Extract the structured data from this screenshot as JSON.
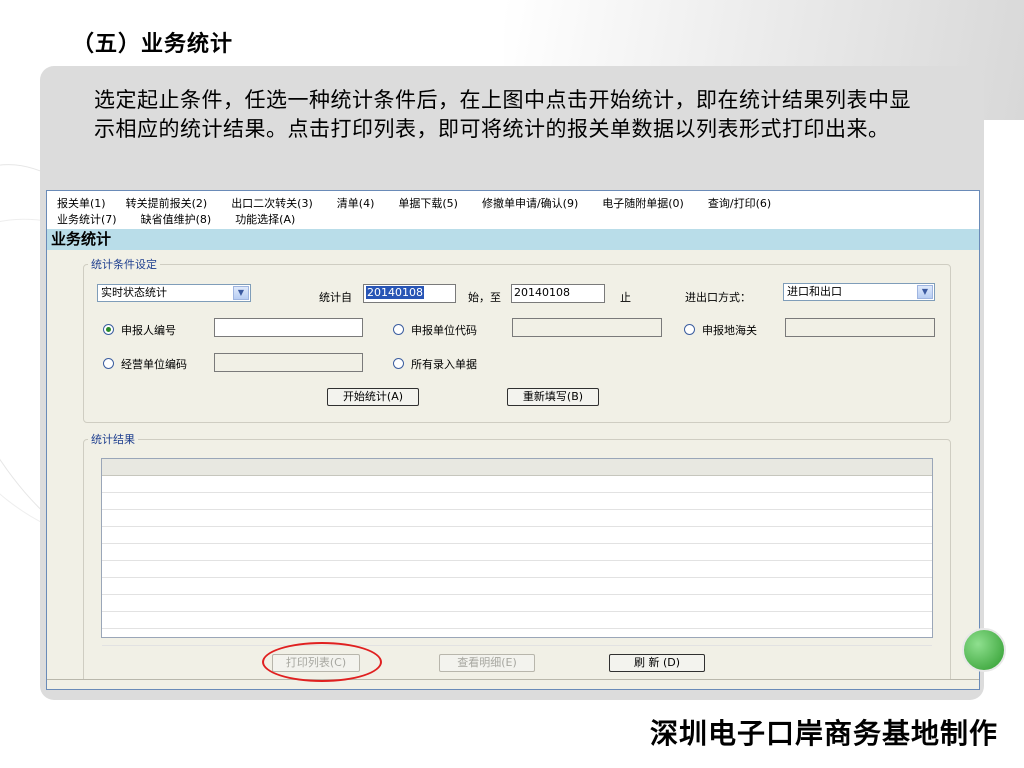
{
  "slide": {
    "title": "（五）业务统计",
    "description": "选定起止条件，任选一种统计条件后，在上图中点击开始统计，即在统计结果列表中显示相应的统计结果。点击打印列表，即可将统计的报关单数据以列表形式打印出来。",
    "footer": "深圳电子口岸商务基地制作"
  },
  "menu": {
    "row1": [
      "报关单(1)",
      "转关提前报关(2)",
      "出口二次转关(3)",
      "清单(4)",
      "单据下载(5)",
      "修撤单申请/确认(9)",
      "电子随附单据(0)",
      "查询/打印(6)"
    ],
    "row2": [
      "业务统计(7)",
      "缺省值维护(8)",
      "功能选择(A)"
    ]
  },
  "window": {
    "title": "业务统计"
  },
  "conditions": {
    "legend": "统计条件设定",
    "stat_type": "实时状态统计",
    "date_from_label": "统计自",
    "date_from": "20140108",
    "date_to_label": "始，至",
    "date_to": "20140108",
    "date_end_label": "止",
    "io_label": "进出口方式：",
    "io_value": "进口和出口",
    "radio_declarer_no": "申报人编号",
    "radio_declare_unit": "申报单位代码",
    "radio_declare_customs": "申报地海关",
    "radio_operating_unit": "经营单位编码",
    "radio_all_entries": "所有录入单据",
    "start_button": "开始统计(A)",
    "refill_button": "重新填写(B)"
  },
  "results": {
    "legend": "统计结果",
    "print_button": "打印列表(C)",
    "detail_button": "查看明细(E)",
    "refresh_button": "刷 新 (D)"
  },
  "colors": {
    "window_bg": "#f1f0e6",
    "titlebar_bg": "#b9dde9",
    "highlight_red": "#e02020",
    "selection_blue": "#2855b5"
  }
}
